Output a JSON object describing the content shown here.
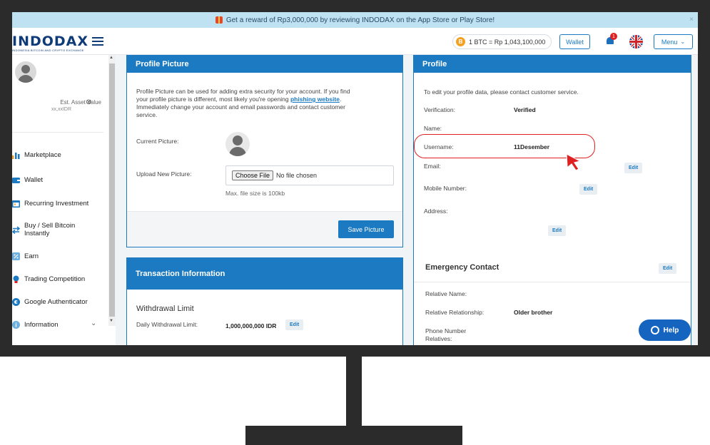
{
  "banner": {
    "text": "Get a reward of Rp3,000,000 by reviewing INDODAX on the App Store or Play Store!",
    "close": "×"
  },
  "topbar": {
    "logo": "INDODAX",
    "logo_sub": "INDONESIA BITCOIN AND CRYPTO EXCHANGE",
    "btc_price": "1 BTC = Rp 1,043,100,000",
    "wallet_label": "Wallet",
    "notification_count": "1",
    "menu_label": "Menu"
  },
  "sidebar": {
    "asset_label": "Est. Asset Value",
    "asset_value": "xx,xxIDR",
    "items": [
      {
        "label": "Marketplace",
        "icon": "chart-icon",
        "color": "#f4a021"
      },
      {
        "label": "Wallet",
        "icon": "wallet-icon",
        "color": "#1b7ac1"
      },
      {
        "label": "Recurring Investment",
        "icon": "calendar-icon",
        "color": "#1b7ac1"
      },
      {
        "label": "Buy / Sell Bitcoin Instantly",
        "icon": "exchange-icon",
        "color": "#1b7ac1"
      },
      {
        "label": "Earn",
        "icon": "percent-icon",
        "color": "#1b7ac1"
      },
      {
        "label": "Trading Competition",
        "icon": "medal-icon",
        "color": "#1b7ac1"
      },
      {
        "label": "Google Authenticator",
        "icon": "google-icon",
        "color": "#1b7ac1"
      },
      {
        "label": "Information",
        "icon": "info-icon",
        "color": "#1b7ac1"
      }
    ]
  },
  "profile_picture": {
    "title": "Profile Picture",
    "desc_1": "Profile Picture can be used for adding extra security for your account. If you find",
    "desc_2": "your profile picture is different, most likely you're opening",
    "desc_link": "phishing website",
    "desc_dot": ".",
    "desc_3": "Immediately change your account and email passwords and contact customer",
    "desc_4": "service.",
    "current_label": "Current Picture:",
    "upload_label": "Upload New Picture:",
    "choose_file": "Choose File",
    "no_file": "No file chosen",
    "max_size": "Max. file size is 100kb",
    "save_button": "Save Picture"
  },
  "transaction": {
    "title": "Transaction Information",
    "withdrawal_title": "Withdrawal Limit",
    "daily_label": "Daily Withdrawal Limit:",
    "daily_value": "1,000,000,000 IDR",
    "edit": "Edit"
  },
  "profile": {
    "title": "Profile",
    "intro": "To edit your profile data, please contact customer service.",
    "verification_label": "Verification:",
    "verification_value": "Verified",
    "name_label": "Name:",
    "username_label": "Username:",
    "username_value": "11Desember",
    "email_label": "Email:",
    "mobile_label": "Mobile Number:",
    "address_label": "Address:",
    "edit": "Edit"
  },
  "emergency": {
    "title": "Emergency Contact",
    "edit": "Edit",
    "relative_name_label": "Relative Name:",
    "relationship_label": "Relative Relationship:",
    "relationship_value": "Older brother",
    "phone_label_1": "Phone Number",
    "phone_label_2": "Relatives:"
  },
  "help": {
    "label": "Help"
  },
  "colors": {
    "brand": "#1b7ac1",
    "highlight": "#e02020",
    "frame": "#2b2b2b"
  }
}
